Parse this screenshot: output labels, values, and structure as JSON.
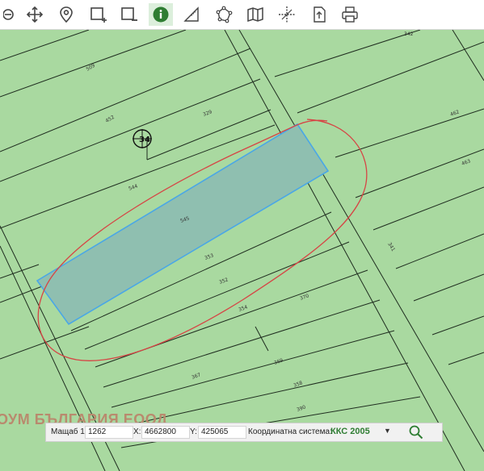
{
  "toolbar": {
    "items": [
      {
        "name": "zoom-out-icon"
      },
      {
        "name": "pan-icon"
      },
      {
        "name": "location-pin-icon"
      },
      {
        "name": "rectangle-select-icon"
      },
      {
        "name": "rectangle-remove-icon"
      },
      {
        "name": "info-icon",
        "active": true
      },
      {
        "name": "measure-icon"
      },
      {
        "name": "polygon-icon"
      },
      {
        "name": "map-icon"
      },
      {
        "name": "grid-crosshair-icon"
      },
      {
        "name": "export-icon"
      },
      {
        "name": "print-icon"
      }
    ]
  },
  "map": {
    "plot_numbers": [
      "509",
      "452",
      "329",
      "544",
      "545",
      "353",
      "352",
      "354",
      "367",
      "369",
      "370",
      "341",
      "342",
      "462",
      "463",
      "358",
      "390",
      "391"
    ],
    "marker_label": "34",
    "watermark": "ОУМ БЪЛГАРИЯ ЕООД",
    "colors": {
      "background": "#a9d9a0",
      "selected_fill": "#8fbfb0",
      "selected_stroke": "#4aa7e6",
      "annotation": "#d64545"
    }
  },
  "coordbar": {
    "scale_label": "Мащаб 1:",
    "scale_value": "1262",
    "x_label": "X:",
    "x_value": "4662800",
    "y_label": "Y:",
    "y_value": "425065",
    "crs_label": "Координатна система:",
    "crs_value": "ККС 2005",
    "dropdown_arrow": "▼"
  }
}
